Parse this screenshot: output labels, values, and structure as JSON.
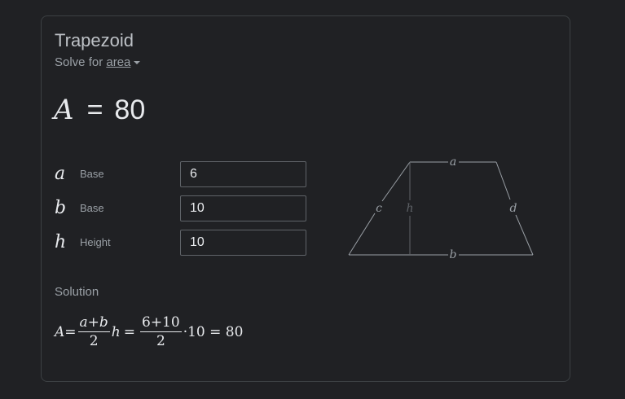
{
  "card": {
    "title": "Trapezoid",
    "solve_prefix": "Solve for",
    "solve_target": "area"
  },
  "result": {
    "symbol": "A",
    "equals": "=",
    "value": "80"
  },
  "inputs": [
    {
      "symbol": "a",
      "label": "Base",
      "value": "6"
    },
    {
      "symbol": "b",
      "label": "Base",
      "value": "10"
    },
    {
      "symbol": "h",
      "label": "Height",
      "value": "10"
    }
  ],
  "solution": {
    "heading": "Solution",
    "lhs": "A",
    "eq1": "=",
    "frac1_num": "a+b",
    "frac1_den": "2",
    "var_h": "h",
    "eq2": "=",
    "frac2_num": "6+10",
    "frac2_den": "2",
    "times": "·10 = 80"
  },
  "diagram": {
    "labels": {
      "a": "a",
      "b": "b",
      "c": "c",
      "d": "d",
      "h": "h"
    },
    "colors": {
      "edge": "#9aa0a6",
      "height_line": "#5f6368",
      "label": "#9aa0a6"
    }
  },
  "colors": {
    "background": "#202124",
    "card_border": "#3c4043",
    "text_primary": "#e8eaed",
    "text_secondary": "#9aa0a6"
  }
}
